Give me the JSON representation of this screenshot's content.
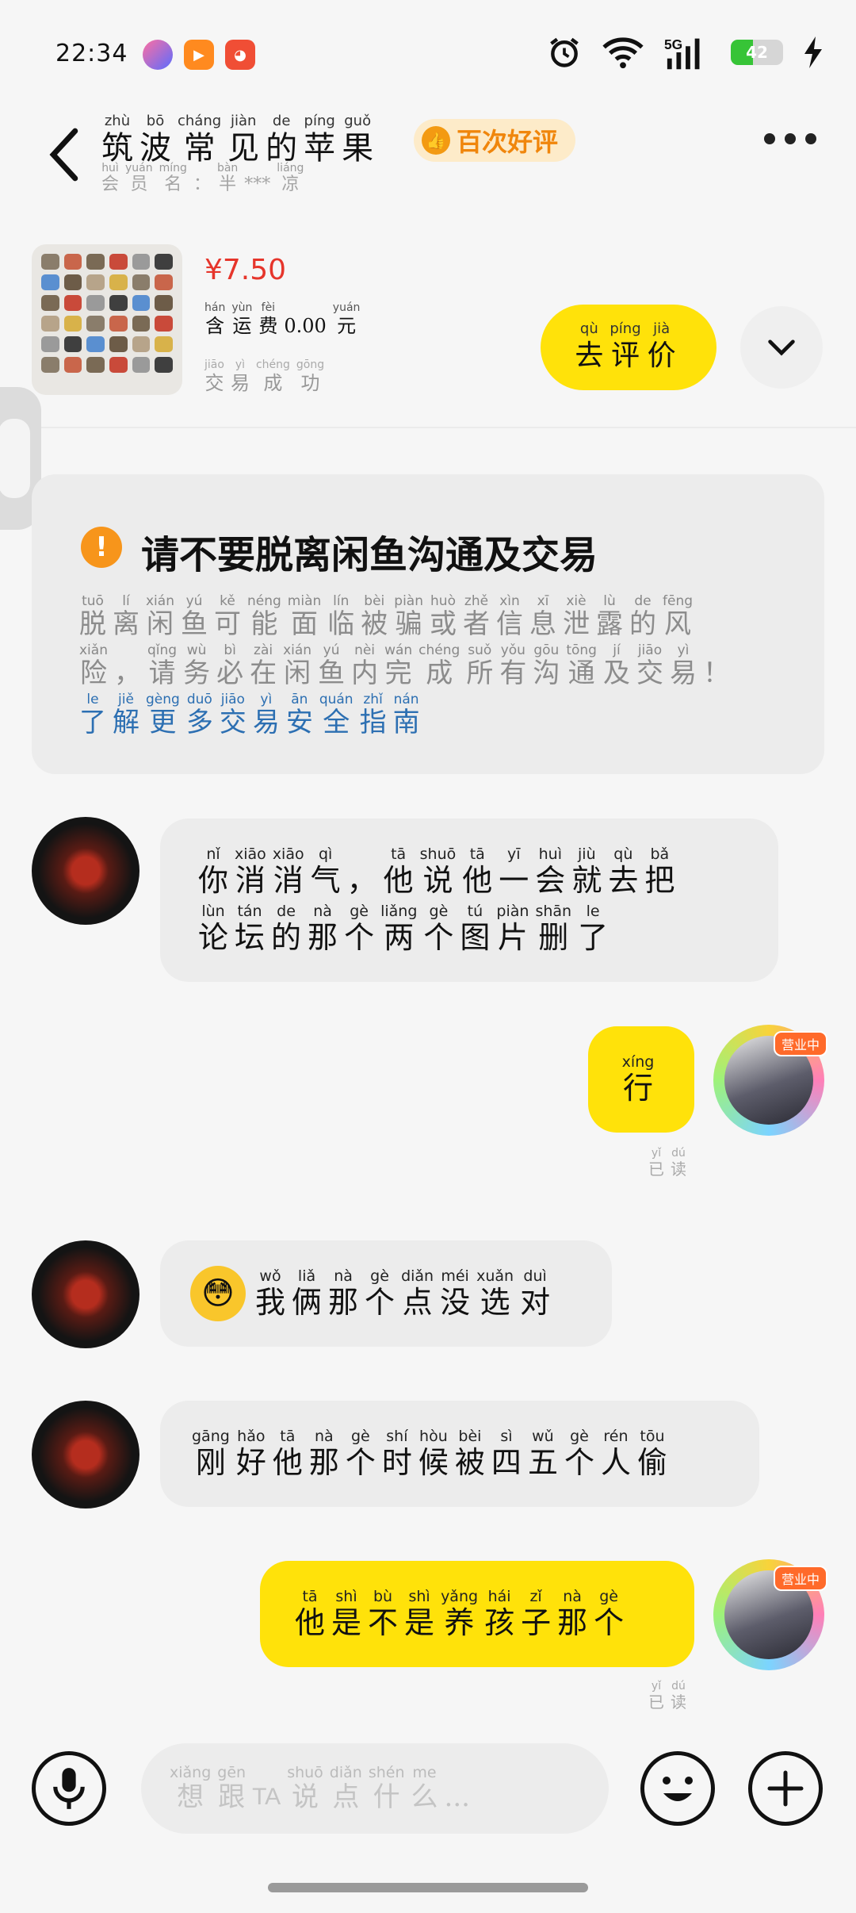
{
  "status_bar": {
    "time": "22:34",
    "battery": 42,
    "network": "5G"
  },
  "header": {
    "title": [
      {
        "py": "zhù",
        "hz": "筑"
      },
      {
        "py": "bō",
        "hz": "波"
      },
      {
        "py": "cháng",
        "hz": "常"
      },
      {
        "py": "jiàn",
        "hz": "见"
      },
      {
        "py": "de",
        "hz": "的"
      },
      {
        "py": "píng",
        "hz": "苹"
      },
      {
        "py": "guǒ",
        "hz": "果"
      }
    ],
    "member": [
      {
        "py": "huì",
        "hz": "会"
      },
      {
        "py": "yuán",
        "hz": "员"
      },
      {
        "py": "míng",
        "hz": "名"
      },
      {
        "py": "",
        "hz": "："
      },
      {
        "py": "bàn",
        "hz": "半"
      },
      {
        "py": "",
        "hz": "***"
      },
      {
        "py": "liáng",
        "hz": "凉"
      }
    ],
    "badge": "百次好评"
  },
  "product": {
    "price": "¥7.50",
    "shipping": [
      {
        "py": "hán",
        "hz": "含"
      },
      {
        "py": "yùn",
        "hz": "运"
      },
      {
        "py": "fèi",
        "hz": "费"
      },
      {
        "py": "",
        "hz": "0.00"
      },
      {
        "py": "yuán",
        "hz": "元"
      }
    ],
    "status": [
      {
        "py": "jiāo",
        "hz": "交"
      },
      {
        "py": "yì",
        "hz": "易"
      },
      {
        "py": "chéng",
        "hz": "成"
      },
      {
        "py": "gōng",
        "hz": "功"
      }
    ],
    "review_button": [
      {
        "py": "qù",
        "hz": "去"
      },
      {
        "py": "píng",
        "hz": "评"
      },
      {
        "py": "jià",
        "hz": "价"
      }
    ]
  },
  "notice": {
    "title": "请不要脱离闲鱼沟通及交易",
    "line1": [
      {
        "py": "tuō",
        "hz": "脱"
      },
      {
        "py": "lí",
        "hz": "离"
      },
      {
        "py": "xián",
        "hz": "闲"
      },
      {
        "py": "yú",
        "hz": "鱼"
      },
      {
        "py": "kě",
        "hz": "可"
      },
      {
        "py": "néng",
        "hz": "能"
      },
      {
        "py": "miàn",
        "hz": "面"
      },
      {
        "py": "lín",
        "hz": "临"
      },
      {
        "py": "bèi",
        "hz": "被"
      },
      {
        "py": "piàn",
        "hz": "骗"
      },
      {
        "py": "huò",
        "hz": "或"
      },
      {
        "py": "zhě",
        "hz": "者"
      },
      {
        "py": "xìn",
        "hz": "信"
      },
      {
        "py": "xī",
        "hz": "息"
      },
      {
        "py": "xiè",
        "hz": "泄"
      },
      {
        "py": "lù",
        "hz": "露"
      },
      {
        "py": "de",
        "hz": "的"
      },
      {
        "py": "fēng",
        "hz": "风"
      }
    ],
    "line2": [
      {
        "py": "xiǎn",
        "hz": "险"
      },
      {
        "py": "",
        "hz": "，"
      },
      {
        "py": "qǐng",
        "hz": "请"
      },
      {
        "py": "wù",
        "hz": "务"
      },
      {
        "py": "bì",
        "hz": "必"
      },
      {
        "py": "zài",
        "hz": "在"
      },
      {
        "py": "xián",
        "hz": "闲"
      },
      {
        "py": "yú",
        "hz": "鱼"
      },
      {
        "py": "nèi",
        "hz": "内"
      },
      {
        "py": "wán",
        "hz": "完"
      },
      {
        "py": "chéng",
        "hz": "成"
      },
      {
        "py": "suǒ",
        "hz": "所"
      },
      {
        "py": "yǒu",
        "hz": "有"
      },
      {
        "py": "gōu",
        "hz": "沟"
      },
      {
        "py": "tōng",
        "hz": "通"
      },
      {
        "py": "jí",
        "hz": "及"
      },
      {
        "py": "jiāo",
        "hz": "交"
      },
      {
        "py": "yì",
        "hz": "易"
      },
      {
        "py": "",
        "hz": "！"
      }
    ],
    "link": [
      {
        "py": "le",
        "hz": "了"
      },
      {
        "py": "jiě",
        "hz": "解"
      },
      {
        "py": "gèng",
        "hz": "更"
      },
      {
        "py": "duō",
        "hz": "多"
      },
      {
        "py": "jiāo",
        "hz": "交"
      },
      {
        "py": "yì",
        "hz": "易"
      },
      {
        "py": "ān",
        "hz": "安"
      },
      {
        "py": "quán",
        "hz": "全"
      },
      {
        "py": "zhǐ",
        "hz": "指"
      },
      {
        "py": "nán",
        "hz": "南"
      }
    ]
  },
  "messages": [
    {
      "side": "left",
      "lines": [
        [
          {
            "py": "nǐ",
            "hz": "你"
          },
          {
            "py": "xiāo",
            "hz": "消"
          },
          {
            "py": "xiāo",
            "hz": "消"
          },
          {
            "py": "qì",
            "hz": "气"
          },
          {
            "py": "",
            "hz": "，"
          },
          {
            "py": "tā",
            "hz": "他"
          },
          {
            "py": "shuō",
            "hz": "说"
          },
          {
            "py": "tā",
            "hz": "他"
          },
          {
            "py": "yī",
            "hz": "一"
          },
          {
            "py": "huì",
            "hz": "会"
          },
          {
            "py": "jiù",
            "hz": "就"
          },
          {
            "py": "qù",
            "hz": "去"
          },
          {
            "py": "bǎ",
            "hz": "把"
          }
        ],
        [
          {
            "py": "lùn",
            "hz": "论"
          },
          {
            "py": "tán",
            "hz": "坛"
          },
          {
            "py": "de",
            "hz": "的"
          },
          {
            "py": "nà",
            "hz": "那"
          },
          {
            "py": "gè",
            "hz": "个"
          },
          {
            "py": "liǎng",
            "hz": "两"
          },
          {
            "py": "gè",
            "hz": "个"
          },
          {
            "py": "tú",
            "hz": "图"
          },
          {
            "py": "piàn",
            "hz": "片"
          },
          {
            "py": "shān",
            "hz": "删"
          },
          {
            "py": "le",
            "hz": "了"
          }
        ]
      ]
    },
    {
      "side": "right",
      "lines": [
        [
          {
            "py": "xíng",
            "hz": "行"
          }
        ]
      ],
      "read": [
        {
          "py": "yǐ",
          "hz": "已"
        },
        {
          "py": "dú",
          "hz": "读"
        }
      ]
    },
    {
      "side": "left",
      "emoji": "😳",
      "lines": [
        [
          {
            "py": "wǒ",
            "hz": "我"
          },
          {
            "py": "liǎ",
            "hz": "俩"
          },
          {
            "py": "nà",
            "hz": "那"
          },
          {
            "py": "gè",
            "hz": "个"
          },
          {
            "py": "diǎn",
            "hz": "点"
          },
          {
            "py": "méi",
            "hz": "没"
          },
          {
            "py": "xuǎn",
            "hz": "选"
          },
          {
            "py": "duì",
            "hz": "对"
          }
        ]
      ]
    },
    {
      "side": "left",
      "lines": [
        [
          {
            "py": "gāng",
            "hz": "刚"
          },
          {
            "py": "hǎo",
            "hz": "好"
          },
          {
            "py": "tā",
            "hz": "他"
          },
          {
            "py": "nà",
            "hz": "那"
          },
          {
            "py": "gè",
            "hz": "个"
          },
          {
            "py": "shí",
            "hz": "时"
          },
          {
            "py": "hòu",
            "hz": "候"
          },
          {
            "py": "bèi",
            "hz": "被"
          },
          {
            "py": "sì",
            "hz": "四"
          },
          {
            "py": "wǔ",
            "hz": "五"
          },
          {
            "py": "gè",
            "hz": "个"
          },
          {
            "py": "rén",
            "hz": "人"
          },
          {
            "py": "tōu",
            "hz": "偷"
          }
        ]
      ]
    },
    {
      "side": "right",
      "lines": [
        [
          {
            "py": "tā",
            "hz": "他"
          },
          {
            "py": "shì",
            "hz": "是"
          },
          {
            "py": "bù",
            "hz": "不"
          },
          {
            "py": "shì",
            "hz": "是"
          },
          {
            "py": "yǎng",
            "hz": "养"
          },
          {
            "py": "hái",
            "hz": "孩"
          },
          {
            "py": "zǐ",
            "hz": "子"
          },
          {
            "py": "nà",
            "hz": "那"
          },
          {
            "py": "gè",
            "hz": "个"
          }
        ]
      ],
      "read": [
        {
          "py": "yǐ",
          "hz": "已"
        },
        {
          "py": "dú",
          "hz": "读"
        }
      ]
    }
  ],
  "input": {
    "placeholder": [
      {
        "py": "xiǎng",
        "hz": "想"
      },
      {
        "py": "gēn",
        "hz": "跟"
      },
      {
        "py": "",
        "hz": "TA",
        "latin": true
      },
      {
        "py": "shuō",
        "hz": "说"
      },
      {
        "py": "diǎn",
        "hz": "点"
      },
      {
        "py": "shén",
        "hz": "什"
      },
      {
        "py": "me",
        "hz": "么"
      },
      {
        "py": "",
        "hz": "..."
      }
    ]
  },
  "colors": {
    "accent": "#ffe20a",
    "price": "#e6352b",
    "warning": "#f7951b",
    "link": "#2c6fb2",
    "badge": "#f0860c"
  }
}
